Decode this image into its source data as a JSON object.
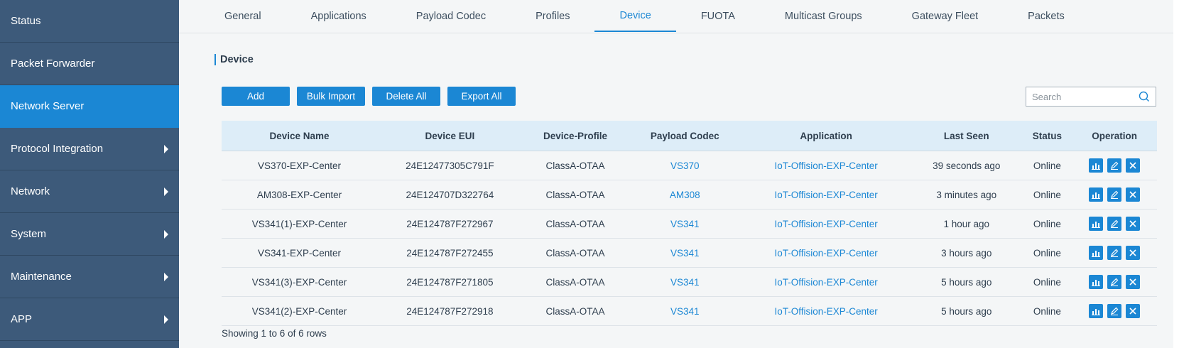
{
  "sidebar": {
    "items": [
      {
        "label": "Status",
        "arrow": false,
        "active": false
      },
      {
        "label": "Packet Forwarder",
        "arrow": false,
        "active": false
      },
      {
        "label": "Network Server",
        "arrow": false,
        "active": true
      },
      {
        "label": "Protocol Integration",
        "arrow": true,
        "active": false
      },
      {
        "label": "Network",
        "arrow": true,
        "active": false
      },
      {
        "label": "System",
        "arrow": true,
        "active": false
      },
      {
        "label": "Maintenance",
        "arrow": true,
        "active": false
      },
      {
        "label": "APP",
        "arrow": true,
        "active": false
      }
    ]
  },
  "tabs": [
    {
      "label": "General",
      "active": false
    },
    {
      "label": "Applications",
      "active": false
    },
    {
      "label": "Payload Codec",
      "active": false
    },
    {
      "label": "Profiles",
      "active": false
    },
    {
      "label": "Device",
      "active": true
    },
    {
      "label": "FUOTA",
      "active": false
    },
    {
      "label": "Multicast Groups",
      "active": false
    },
    {
      "label": "Gateway Fleet",
      "active": false
    },
    {
      "label": "Packets",
      "active": false
    }
  ],
  "section_title": "Device",
  "buttons": {
    "add": "Add",
    "bulk_import": "Bulk Import",
    "delete_all": "Delete All",
    "export_all": "Export All"
  },
  "search": {
    "placeholder": "Search"
  },
  "table": {
    "headers": [
      "Device Name",
      "Device EUI",
      "Device-Profile",
      "Payload Codec",
      "Application",
      "Last Seen",
      "Status",
      "Operation"
    ],
    "rows": [
      [
        "VS370-EXP-Center",
        "24E12477305C791F",
        "ClassA-OTAA",
        "VS370",
        "IoT-Offision-EXP-Center",
        "39 seconds ago",
        "Online"
      ],
      [
        "AM308-EXP-Center",
        "24E124707D322764",
        "ClassA-OTAA",
        "AM308",
        "IoT-Offision-EXP-Center",
        "3 minutes ago",
        "Online"
      ],
      [
        "VS341(1)-EXP-Center",
        "24E124787F272967",
        "ClassA-OTAA",
        "VS341",
        "IoT-Offision-EXP-Center",
        "1 hour ago",
        "Online"
      ],
      [
        "VS341-EXP-Center",
        "24E124787F272455",
        "ClassA-OTAA",
        "VS341",
        "IoT-Offision-EXP-Center",
        "3 hours ago",
        "Online"
      ],
      [
        "VS341(3)-EXP-Center",
        "24E124787F271805",
        "ClassA-OTAA",
        "VS341",
        "IoT-Offision-EXP-Center",
        "5 hours ago",
        "Online"
      ],
      [
        "VS341(2)-EXP-Center",
        "24E124787F272918",
        "ClassA-OTAA",
        "VS341",
        "IoT-Offision-EXP-Center",
        "5 hours ago",
        "Online"
      ]
    ]
  },
  "footer": "Showing 1 to 6 of 6 rows",
  "icons": {
    "operation": [
      "chart-icon",
      "edit-icon",
      "delete-icon"
    ],
    "search": "search-icon"
  },
  "colors": {
    "accent": "#1b87d4",
    "sidebar": "#3d5a7a"
  }
}
